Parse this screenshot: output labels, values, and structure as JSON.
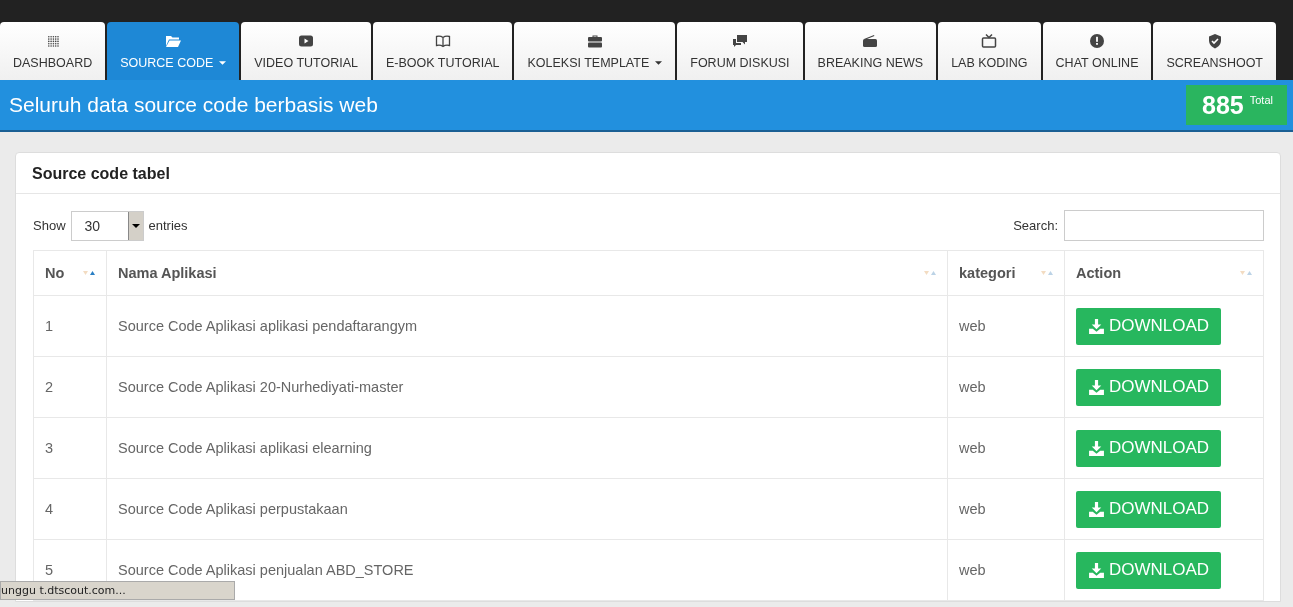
{
  "tabs": [
    {
      "label": "DASHBOARD",
      "selected": false,
      "dropdown": false
    },
    {
      "label": "SOURCE CODE",
      "selected": true,
      "dropdown": true
    },
    {
      "label": "VIDEO TUTORIAL",
      "selected": false,
      "dropdown": false
    },
    {
      "label": "E-BOOK TUTORIAL",
      "selected": false,
      "dropdown": false
    },
    {
      "label": "KOLEKSI TEMPLATE",
      "selected": false,
      "dropdown": true
    },
    {
      "label": "FORUM DISKUSI",
      "selected": false,
      "dropdown": false
    },
    {
      "label": "BREAKING NEWS",
      "selected": false,
      "dropdown": false
    },
    {
      "label": "LAB KODING",
      "selected": false,
      "dropdown": false
    },
    {
      "label": "CHAT ONLINE",
      "selected": false,
      "dropdown": false
    },
    {
      "label": "SCREANSHOOT",
      "selected": false,
      "dropdown": false
    }
  ],
  "header": {
    "title": "Seluruh data source code berbasis web",
    "count": "885",
    "count_label": "Total"
  },
  "card": {
    "title": "Source code tabel",
    "show_label": "Show",
    "entries_value": "30",
    "entries_label": "entries",
    "search_label": "Search:"
  },
  "table": {
    "columns": [
      {
        "label": "No",
        "sorted": true
      },
      {
        "label": "Nama Aplikasi",
        "sorted": false
      },
      {
        "label": "kategori",
        "sorted": false
      },
      {
        "label": "Action",
        "sorted": false
      }
    ],
    "rows": [
      {
        "no": "1",
        "name": "Source Code Aplikasi aplikasi pendaftarangym",
        "category": "web",
        "action": "DOWNLOAD"
      },
      {
        "no": "2",
        "name": "Source Code Aplikasi 20-Nurhediyati-master",
        "category": "web",
        "action": "DOWNLOAD"
      },
      {
        "no": "3",
        "name": "Source Code Aplikasi aplikasi elearning",
        "category": "web",
        "action": "DOWNLOAD"
      },
      {
        "no": "4",
        "name": "Source Code Aplikasi perpustakaan",
        "category": "web",
        "action": "DOWNLOAD"
      },
      {
        "no": "5",
        "name": "Source Code Aplikasi penjualan ABD_STORE",
        "category": "web",
        "action": "DOWNLOAD"
      }
    ]
  },
  "status_bar": {
    "text": "unggu t.dtscout.com..."
  }
}
